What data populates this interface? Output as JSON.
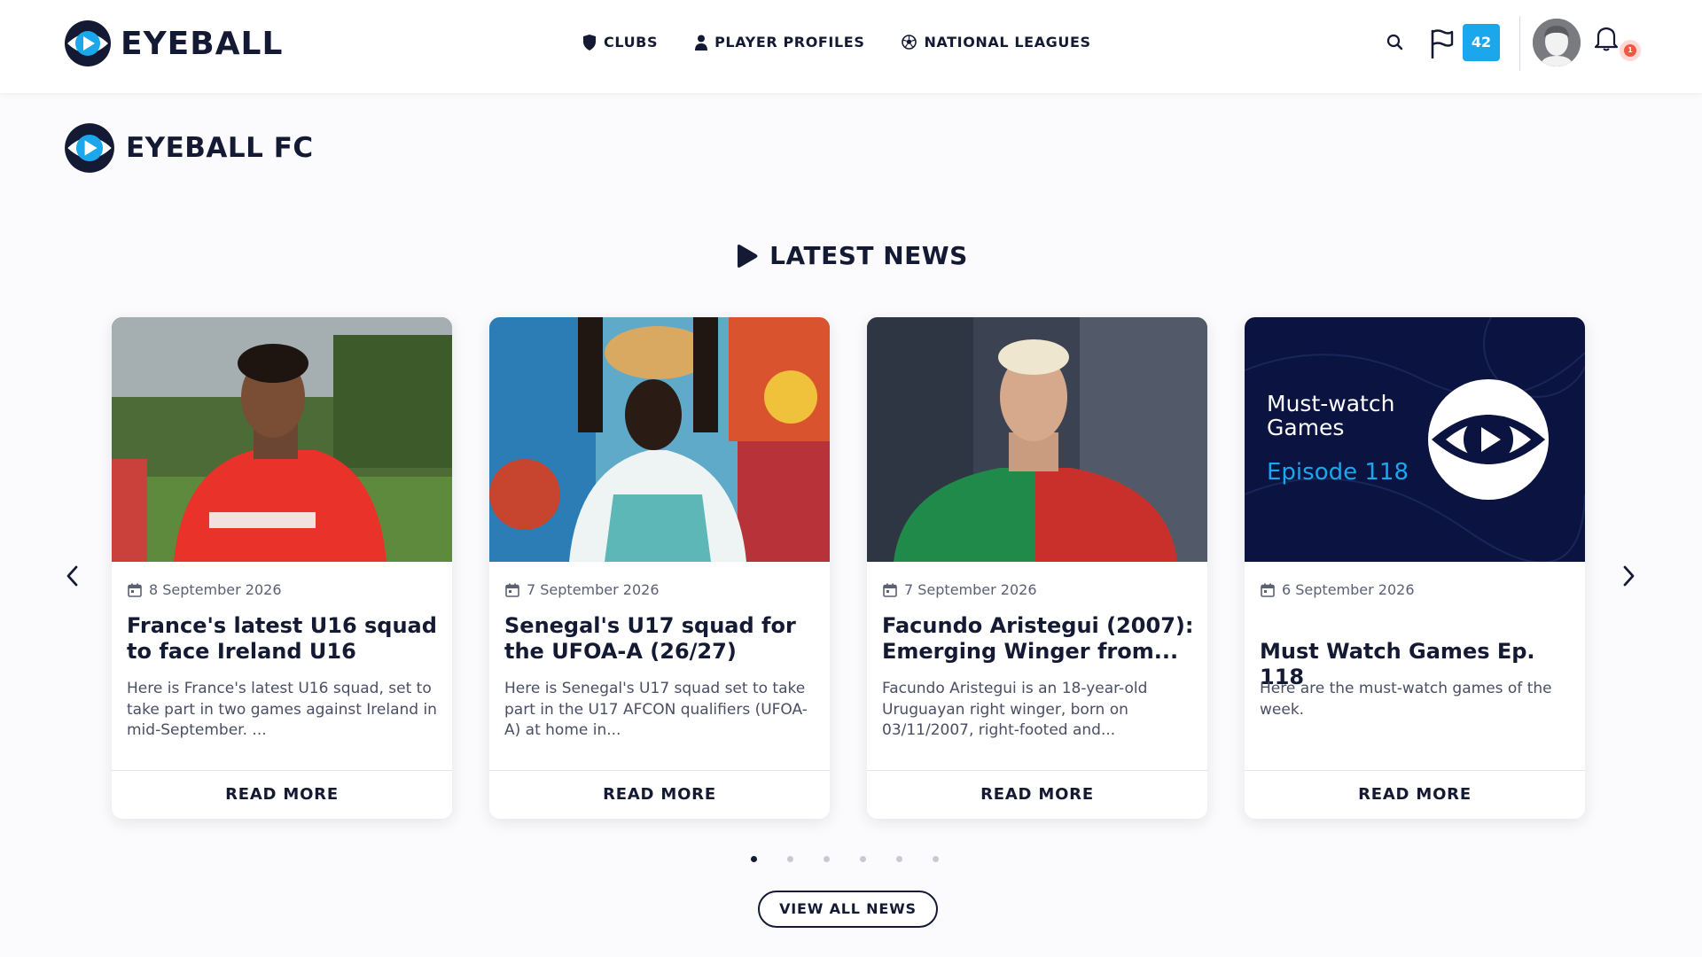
{
  "header": {
    "brand": "EYEBALL",
    "nav": [
      {
        "label": "CLUBS",
        "icon": "shield-icon"
      },
      {
        "label": "PLAYER PROFILES",
        "icon": "person-icon"
      },
      {
        "label": "NATIONAL LEAGUES",
        "icon": "soccer-ball-icon"
      }
    ],
    "flag_count": "42",
    "notification_count": "1"
  },
  "club": {
    "name": "EYEBALL FC"
  },
  "news": {
    "title": "LATEST NEWS",
    "cards": [
      {
        "date": "8 September 2026",
        "title": "France's latest U16 squad to face Ireland U16",
        "excerpt": "Here is France's latest U16 squad, set to take part in two games against Ireland in mid-September. ...",
        "button": "READ MORE"
      },
      {
        "date": "7 September 2026",
        "title": "Senegal's U17 squad for the UFOA-A (26/27)",
        "excerpt": "Here is Senegal's U17 squad set to take part in the U17 AFCON qualifiers (UFOA-A) at home in...",
        "button": "READ MORE"
      },
      {
        "date": "7 September 2026",
        "title": "Facundo Aristegui (2007): Emerging Winger from...",
        "excerpt": "Facundo Aristegui is an 18-year-old Uruguayan right winger, born on 03/11/2007, right-footed and...",
        "button": "READ MORE"
      },
      {
        "date": "6 September 2026",
        "title": "Must Watch Games Ep. 118",
        "excerpt": "Here are the must-watch games of the week.",
        "button": "READ MORE",
        "image_heading": "Must-watch Games",
        "image_episode": "Episode 118"
      }
    ],
    "pagination_count": 6,
    "active_page": 1,
    "view_all": "VIEW ALL NEWS"
  },
  "colors": {
    "navy": "#141a33",
    "accent_blue": "#1ba7ec",
    "notification_red": "#f2573f",
    "must_watch_bg": "#0b1440"
  }
}
